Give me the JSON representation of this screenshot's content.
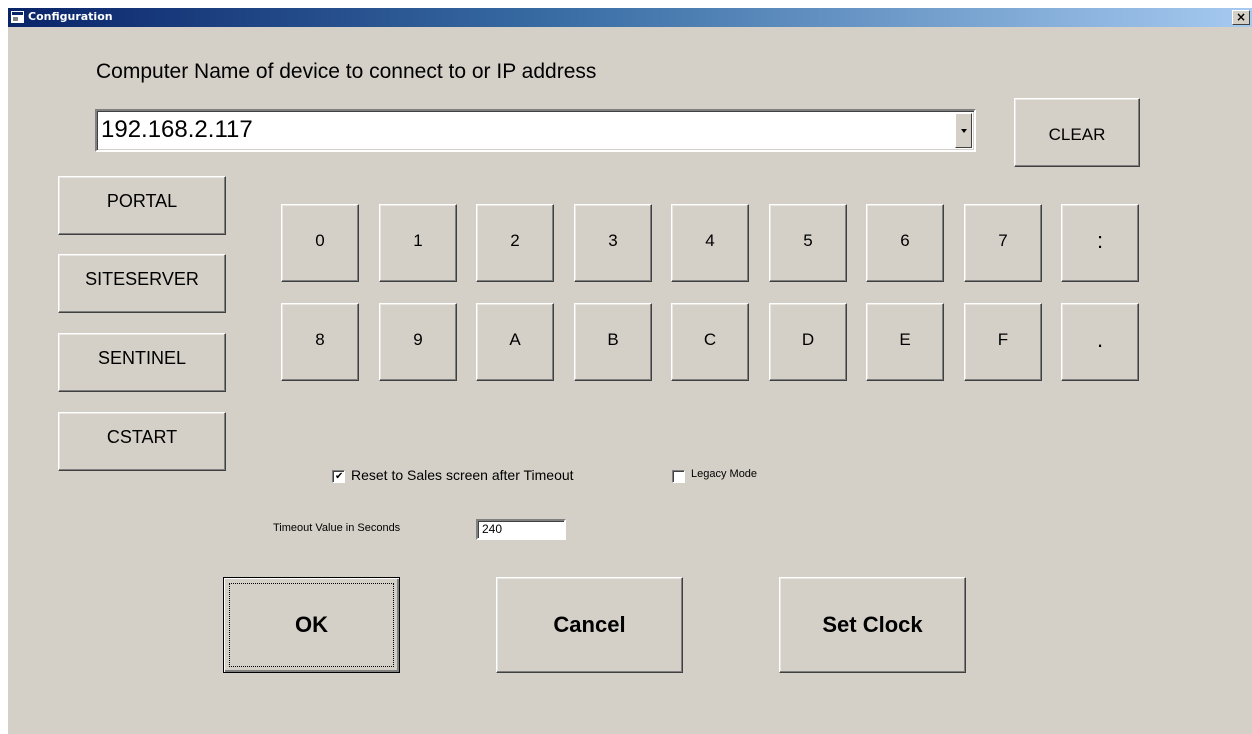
{
  "window": {
    "title": "Configuration",
    "close_glyph": "×",
    "app_icon": "app-window-icon"
  },
  "prompt_label": "Computer Name of device to connect to or IP address",
  "address": {
    "value": "192.168.2.117",
    "dropdown_icon": "chevron-down-icon"
  },
  "clear_label": "CLEAR",
  "side_buttons": [
    "PORTAL",
    "SITESERVER",
    "SENTINEL",
    "CSTART"
  ],
  "keypad": {
    "row1": [
      "0",
      "1",
      "2",
      "3",
      "4",
      "5",
      "6",
      "7",
      ":"
    ],
    "row2": [
      "8",
      "9",
      "A",
      "B",
      "C",
      "D",
      "E",
      "F",
      "."
    ]
  },
  "options": {
    "reset_label": "Reset to Sales screen after Timeout",
    "reset_checked": true,
    "legacy_label": "Legacy Mode",
    "legacy_checked": false
  },
  "timeout": {
    "label": "Timeout Value in Seconds",
    "value": "240"
  },
  "actions": {
    "ok": "OK",
    "cancel": "Cancel",
    "set_clock": "Set Clock"
  },
  "colors": {
    "face": "#d4d0c8",
    "title_start": "#0a246a",
    "title_end": "#a6caf0"
  }
}
